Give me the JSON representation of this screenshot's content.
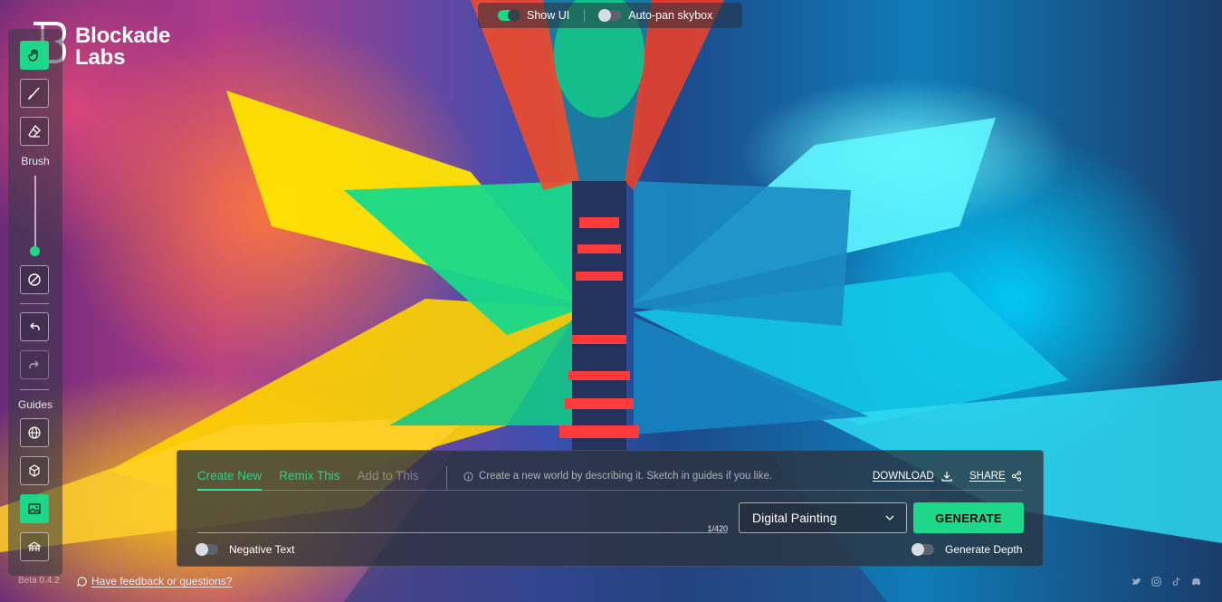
{
  "topbar": {
    "show_ui_label": "Show UI",
    "show_ui_on": true,
    "autopan_label": "Auto-pan skybox",
    "autopan_on": false
  },
  "logo": {
    "line1": "Blockade",
    "line2": "Labs"
  },
  "toolbar": {
    "brush_label": "Brush",
    "guides_label": "Guides",
    "brush_size": 0.15
  },
  "footer": {
    "version": "Beta 0.4.2",
    "feedback": "Have feedback or questions?"
  },
  "panel": {
    "tabs": [
      {
        "label": "Create New",
        "state": "active"
      },
      {
        "label": "Remix This",
        "state": "enabled"
      },
      {
        "label": "Add to This",
        "state": "disabled"
      }
    ],
    "hint": "Create a new world by describing it. Sketch in guides if you like.",
    "download_label": "DOWNLOAD",
    "share_label": "SHARE",
    "prompt_value": "",
    "counter": "1/420",
    "style_value": "Digital Painting",
    "generate_label": "GENERATE",
    "negative_text_label": "Negative Text",
    "negative_text_on": false,
    "generate_depth_label": "Generate Depth",
    "generate_depth_on": false
  },
  "colors": {
    "accent": "#1ed88a",
    "panel": "#2c323c"
  },
  "icons": {
    "social": [
      "twitter-icon",
      "instagram-icon",
      "tiktok-icon",
      "discord-icon"
    ]
  }
}
